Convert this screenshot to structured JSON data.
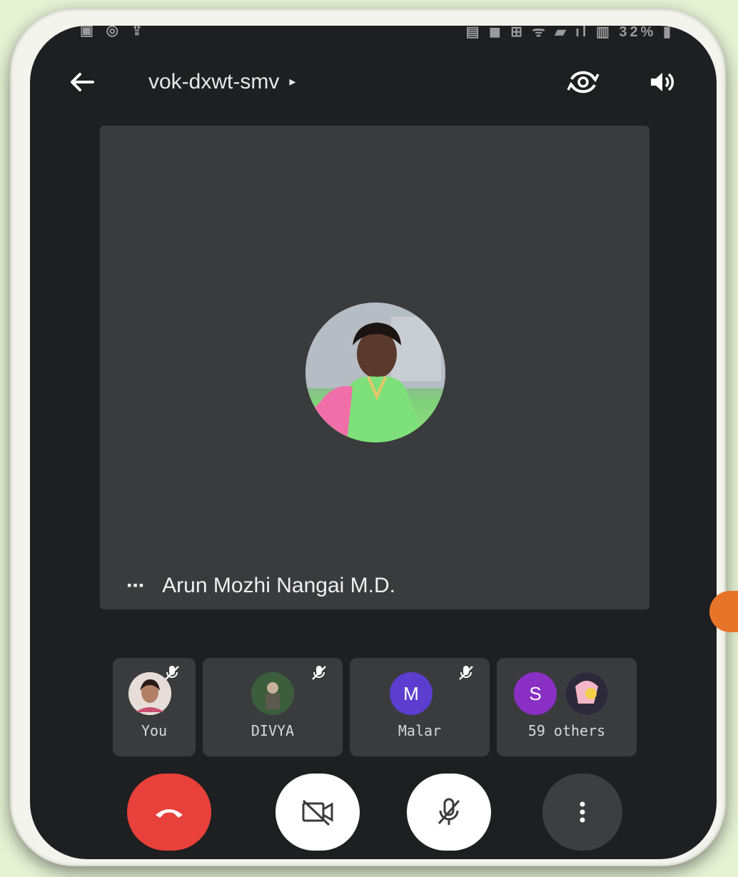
{
  "status_bar": {
    "left": "▣ ◎ ⇪",
    "right": "▤ ◼ ⊞ ᯤ ▰ ıl ▥ 32% ▮"
  },
  "header": {
    "meeting_code": "vok-dxwt-smv",
    "caret": "▸"
  },
  "main_tile": {
    "speaker_name": "Arun Mozhi Nangai M.D.",
    "dots": "▪▪▪"
  },
  "participants": [
    {
      "label": "You",
      "avatar": "photo"
    },
    {
      "label": "DIVYA",
      "avatar": "photo"
    },
    {
      "label": "Malar",
      "avatar": "letter",
      "initial": "M",
      "color": "#5b3ecf"
    },
    {
      "label": "59 others",
      "avatar": "letter",
      "initial": "S",
      "color": "#8a2fc4"
    }
  ],
  "colors": {
    "end_call": "#e8403a",
    "background": "#1e1f21",
    "tile": "#3a3b3d"
  },
  "icons": [
    "back-arrow-icon",
    "switch-camera-icon",
    "speaker-icon",
    "mic-off-icon",
    "camera-off-icon",
    "end-call-icon",
    "more-vert-icon"
  ]
}
